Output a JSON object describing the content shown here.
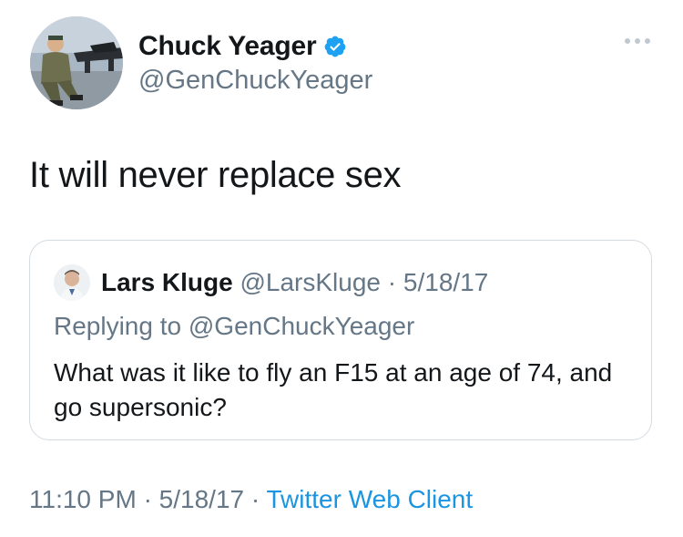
{
  "tweet": {
    "author_name": "Chuck Yeager",
    "author_handle": "@GenChuckYeager",
    "text": "It will never replace sex",
    "time": "11:10 PM",
    "date": "5/18/17",
    "separator": "·",
    "source": "Twitter Web Client",
    "verified_icon": "verified-badge-icon",
    "more_icon": "more-options-icon"
  },
  "quoted_tweet": {
    "author_name": "Lars Kluge",
    "author_handle": "@LarsKluge",
    "separator": "·",
    "date": "5/18/17",
    "replying_to_prefix": "Replying to",
    "replying_to_handle": "@GenChuckYeager",
    "text": "What was it like to fly an F15 at an age of 74, and go supersonic?"
  },
  "colors": {
    "text_primary": "#14171a",
    "text_secondary": "#657786",
    "link": "#1b95e0",
    "verified": "#1da1f2",
    "border": "#d4dbe1"
  }
}
